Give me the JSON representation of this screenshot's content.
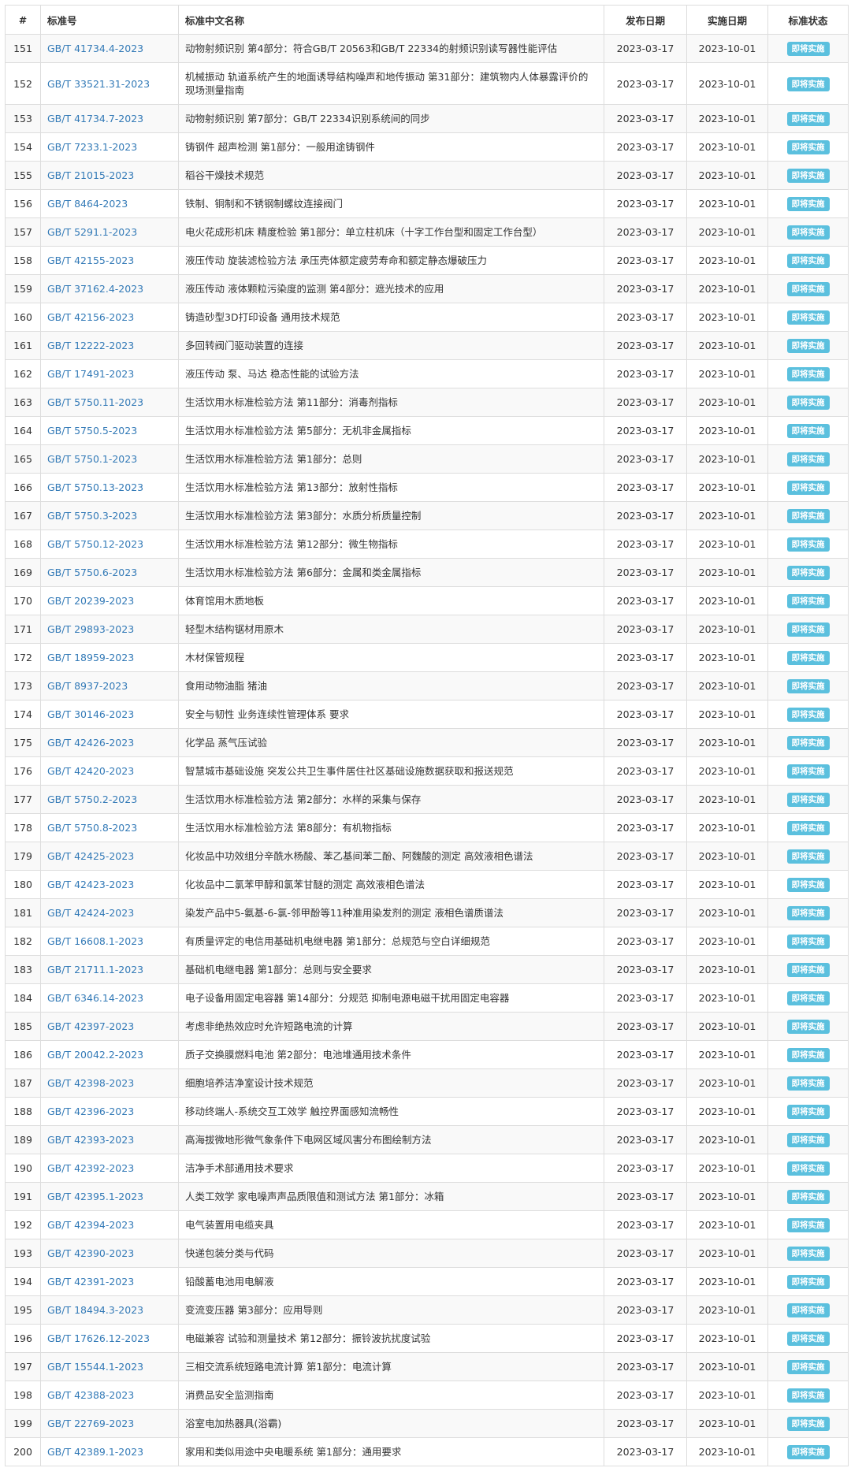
{
  "headers": {
    "num": "#",
    "code": "标准号",
    "name": "标准中文名称",
    "publish": "发布日期",
    "implement": "实施日期",
    "status": "标准状态"
  },
  "colors": {
    "link": "#337ab7",
    "badge": "#5bc0de",
    "stripe": "#f9f9f9",
    "border": "#dddddd"
  },
  "rows": [
    {
      "num": "151",
      "code": "GB/T 41734.4-2023",
      "name": "动物射频识别 第4部分：符合GB/T 20563和GB/T 22334的射频识别读写器性能评估",
      "publish": "2023-03-17",
      "implement": "2023-10-01",
      "status": "即将实施"
    },
    {
      "num": "152",
      "code": "GB/T 33521.31-2023",
      "name": "机械振动 轨道系统产生的地面诱导结构噪声和地传振动 第31部分：建筑物内人体暴露评价的现场测量指南",
      "publish": "2023-03-17",
      "implement": "2023-10-01",
      "status": "即将实施"
    },
    {
      "num": "153",
      "code": "GB/T 41734.7-2023",
      "name": "动物射频识别 第7部分：GB/T 22334识别系统间的同步",
      "publish": "2023-03-17",
      "implement": "2023-10-01",
      "status": "即将实施"
    },
    {
      "num": "154",
      "code": "GB/T 7233.1-2023",
      "name": "铸钢件 超声检测 第1部分：一般用途铸钢件",
      "publish": "2023-03-17",
      "implement": "2023-10-01",
      "status": "即将实施"
    },
    {
      "num": "155",
      "code": "GB/T 21015-2023",
      "name": "稻谷干燥技术规范",
      "publish": "2023-03-17",
      "implement": "2023-10-01",
      "status": "即将实施"
    },
    {
      "num": "156",
      "code": "GB/T 8464-2023",
      "name": "铁制、铜制和不锈钢制螺纹连接阀门",
      "publish": "2023-03-17",
      "implement": "2023-10-01",
      "status": "即将实施"
    },
    {
      "num": "157",
      "code": "GB/T 5291.1-2023",
      "name": "电火花成形机床 精度检验 第1部分：单立柱机床（十字工作台型和固定工作台型）",
      "publish": "2023-03-17",
      "implement": "2023-10-01",
      "status": "即将实施"
    },
    {
      "num": "158",
      "code": "GB/T 42155-2023",
      "name": "液压传动 旋装滤检验方法 承压壳体额定疲劳寿命和额定静态爆破压力",
      "publish": "2023-03-17",
      "implement": "2023-10-01",
      "status": "即将实施"
    },
    {
      "num": "159",
      "code": "GB/T 37162.4-2023",
      "name": "液压传动 液体颗粒污染度的监测 第4部分：遮光技术的应用",
      "publish": "2023-03-17",
      "implement": "2023-10-01",
      "status": "即将实施"
    },
    {
      "num": "160",
      "code": "GB/T 42156-2023",
      "name": "铸造砂型3D打印设备 通用技术规范",
      "publish": "2023-03-17",
      "implement": "2023-10-01",
      "status": "即将实施"
    },
    {
      "num": "161",
      "code": "GB/T 12222-2023",
      "name": "多回转阀门驱动装置的连接",
      "publish": "2023-03-17",
      "implement": "2023-10-01",
      "status": "即将实施"
    },
    {
      "num": "162",
      "code": "GB/T 17491-2023",
      "name": "液压传动 泵、马达 稳态性能的试验方法",
      "publish": "2023-03-17",
      "implement": "2023-10-01",
      "status": "即将实施"
    },
    {
      "num": "163",
      "code": "GB/T 5750.11-2023",
      "name": "生活饮用水标准检验方法 第11部分：消毒剂指标",
      "publish": "2023-03-17",
      "implement": "2023-10-01",
      "status": "即将实施"
    },
    {
      "num": "164",
      "code": "GB/T 5750.5-2023",
      "name": "生活饮用水标准检验方法 第5部分：无机非金属指标",
      "publish": "2023-03-17",
      "implement": "2023-10-01",
      "status": "即将实施"
    },
    {
      "num": "165",
      "code": "GB/T 5750.1-2023",
      "name": "生活饮用水标准检验方法 第1部分：总则",
      "publish": "2023-03-17",
      "implement": "2023-10-01",
      "status": "即将实施"
    },
    {
      "num": "166",
      "code": "GB/T 5750.13-2023",
      "name": "生活饮用水标准检验方法 第13部分：放射性指标",
      "publish": "2023-03-17",
      "implement": "2023-10-01",
      "status": "即将实施"
    },
    {
      "num": "167",
      "code": "GB/T 5750.3-2023",
      "name": "生活饮用水标准检验方法 第3部分：水质分析质量控制",
      "publish": "2023-03-17",
      "implement": "2023-10-01",
      "status": "即将实施"
    },
    {
      "num": "168",
      "code": "GB/T 5750.12-2023",
      "name": "生活饮用水标准检验方法 第12部分：微生物指标",
      "publish": "2023-03-17",
      "implement": "2023-10-01",
      "status": "即将实施"
    },
    {
      "num": "169",
      "code": "GB/T 5750.6-2023",
      "name": "生活饮用水标准检验方法 第6部分：金属和类金属指标",
      "publish": "2023-03-17",
      "implement": "2023-10-01",
      "status": "即将实施"
    },
    {
      "num": "170",
      "code": "GB/T 20239-2023",
      "name": "体育馆用木质地板",
      "publish": "2023-03-17",
      "implement": "2023-10-01",
      "status": "即将实施"
    },
    {
      "num": "171",
      "code": "GB/T 29893-2023",
      "name": "轻型木结构锯材用原木",
      "publish": "2023-03-17",
      "implement": "2023-10-01",
      "status": "即将实施"
    },
    {
      "num": "172",
      "code": "GB/T 18959-2023",
      "name": "木材保管规程",
      "publish": "2023-03-17",
      "implement": "2023-10-01",
      "status": "即将实施"
    },
    {
      "num": "173",
      "code": "GB/T 8937-2023",
      "name": "食用动物油脂 猪油",
      "publish": "2023-03-17",
      "implement": "2023-10-01",
      "status": "即将实施"
    },
    {
      "num": "174",
      "code": "GB/T 30146-2023",
      "name": "安全与韧性 业务连续性管理体系 要求",
      "publish": "2023-03-17",
      "implement": "2023-10-01",
      "status": "即将实施"
    },
    {
      "num": "175",
      "code": "GB/T 42426-2023",
      "name": "化学品 蒸气压试验",
      "publish": "2023-03-17",
      "implement": "2023-10-01",
      "status": "即将实施"
    },
    {
      "num": "176",
      "code": "GB/T 42420-2023",
      "name": "智慧城市基础设施 突发公共卫生事件居住社区基础设施数据获取和报送规范",
      "publish": "2023-03-17",
      "implement": "2023-10-01",
      "status": "即将实施"
    },
    {
      "num": "177",
      "code": "GB/T 5750.2-2023",
      "name": "生活饮用水标准检验方法 第2部分：水样的采集与保存",
      "publish": "2023-03-17",
      "implement": "2023-10-01",
      "status": "即将实施"
    },
    {
      "num": "178",
      "code": "GB/T 5750.8-2023",
      "name": "生活饮用水标准检验方法 第8部分：有机物指标",
      "publish": "2023-03-17",
      "implement": "2023-10-01",
      "status": "即将实施"
    },
    {
      "num": "179",
      "code": "GB/T 42425-2023",
      "name": "化妆品中功效组分辛酰水杨酸、苯乙基间苯二酚、阿魏酸的测定 高效液相色谱法",
      "publish": "2023-03-17",
      "implement": "2023-10-01",
      "status": "即将实施"
    },
    {
      "num": "180",
      "code": "GB/T 42423-2023",
      "name": "化妆品中二氯苯甲醇和氯苯甘醚的测定 高效液相色谱法",
      "publish": "2023-03-17",
      "implement": "2023-10-01",
      "status": "即将实施"
    },
    {
      "num": "181",
      "code": "GB/T 42424-2023",
      "name": "染发产品中5-氨基-6-氯-邻甲酚等11种准用染发剂的测定 液相色谱质谱法",
      "publish": "2023-03-17",
      "implement": "2023-10-01",
      "status": "即将实施"
    },
    {
      "num": "182",
      "code": "GB/T 16608.1-2023",
      "name": "有质量评定的电信用基础机电继电器 第1部分：总规范与空白详细规范",
      "publish": "2023-03-17",
      "implement": "2023-10-01",
      "status": "即将实施"
    },
    {
      "num": "183",
      "code": "GB/T 21711.1-2023",
      "name": "基础机电继电器 第1部分：总则与安全要求",
      "publish": "2023-03-17",
      "implement": "2023-10-01",
      "status": "即将实施"
    },
    {
      "num": "184",
      "code": "GB/T 6346.14-2023",
      "name": "电子设备用固定电容器 第14部分：分规范 抑制电源电磁干扰用固定电容器",
      "publish": "2023-03-17",
      "implement": "2023-10-01",
      "status": "即将实施"
    },
    {
      "num": "185",
      "code": "GB/T 42397-2023",
      "name": "考虑非绝热效应时允许短路电流的计算",
      "publish": "2023-03-17",
      "implement": "2023-10-01",
      "status": "即将实施"
    },
    {
      "num": "186",
      "code": "GB/T 20042.2-2023",
      "name": "质子交换膜燃料电池 第2部分：电池堆通用技术条件",
      "publish": "2023-03-17",
      "implement": "2023-10-01",
      "status": "即将实施"
    },
    {
      "num": "187",
      "code": "GB/T 42398-2023",
      "name": "细胞培养洁净室设计技术规范",
      "publish": "2023-03-17",
      "implement": "2023-10-01",
      "status": "即将实施"
    },
    {
      "num": "188",
      "code": "GB/T 42396-2023",
      "name": "移动终端人-系统交互工效学 触控界面感知流畅性",
      "publish": "2023-03-17",
      "implement": "2023-10-01",
      "status": "即将实施"
    },
    {
      "num": "189",
      "code": "GB/T 42393-2023",
      "name": "高海拔微地形微气象条件下电网区域风害分布图绘制方法",
      "publish": "2023-03-17",
      "implement": "2023-10-01",
      "status": "即将实施"
    },
    {
      "num": "190",
      "code": "GB/T 42392-2023",
      "name": "洁净手术部通用技术要求",
      "publish": "2023-03-17",
      "implement": "2023-10-01",
      "status": "即将实施"
    },
    {
      "num": "191",
      "code": "GB/T 42395.1-2023",
      "name": "人类工效学 家电噪声声品质限值和测试方法 第1部分：冰箱",
      "publish": "2023-03-17",
      "implement": "2023-10-01",
      "status": "即将实施"
    },
    {
      "num": "192",
      "code": "GB/T 42394-2023",
      "name": "电气装置用电缆夹具",
      "publish": "2023-03-17",
      "implement": "2023-10-01",
      "status": "即将实施"
    },
    {
      "num": "193",
      "code": "GB/T 42390-2023",
      "name": "快递包装分类与代码",
      "publish": "2023-03-17",
      "implement": "2023-10-01",
      "status": "即将实施"
    },
    {
      "num": "194",
      "code": "GB/T 42391-2023",
      "name": "铅酸蓄电池用电解液",
      "publish": "2023-03-17",
      "implement": "2023-10-01",
      "status": "即将实施"
    },
    {
      "num": "195",
      "code": "GB/T 18494.3-2023",
      "name": "变流变压器 第3部分：应用导则",
      "publish": "2023-03-17",
      "implement": "2023-10-01",
      "status": "即将实施"
    },
    {
      "num": "196",
      "code": "GB/T 17626.12-2023",
      "name": "电磁兼容 试验和测量技术 第12部分：振铃波抗扰度试验",
      "publish": "2023-03-17",
      "implement": "2023-10-01",
      "status": "即将实施"
    },
    {
      "num": "197",
      "code": "GB/T 15544.1-2023",
      "name": "三相交流系统短路电流计算 第1部分：电流计算",
      "publish": "2023-03-17",
      "implement": "2023-10-01",
      "status": "即将实施"
    },
    {
      "num": "198",
      "code": "GB/T 42388-2023",
      "name": "消费品安全监测指南",
      "publish": "2023-03-17",
      "implement": "2023-10-01",
      "status": "即将实施"
    },
    {
      "num": "199",
      "code": "GB/T 22769-2023",
      "name": "浴室电加热器具(浴霸)",
      "publish": "2023-03-17",
      "implement": "2023-10-01",
      "status": "即将实施"
    },
    {
      "num": "200",
      "code": "GB/T 42389.1-2023",
      "name": "家用和类似用途中央电暖系统 第1部分：通用要求",
      "publish": "2023-03-17",
      "implement": "2023-10-01",
      "status": "即将实施"
    }
  ]
}
